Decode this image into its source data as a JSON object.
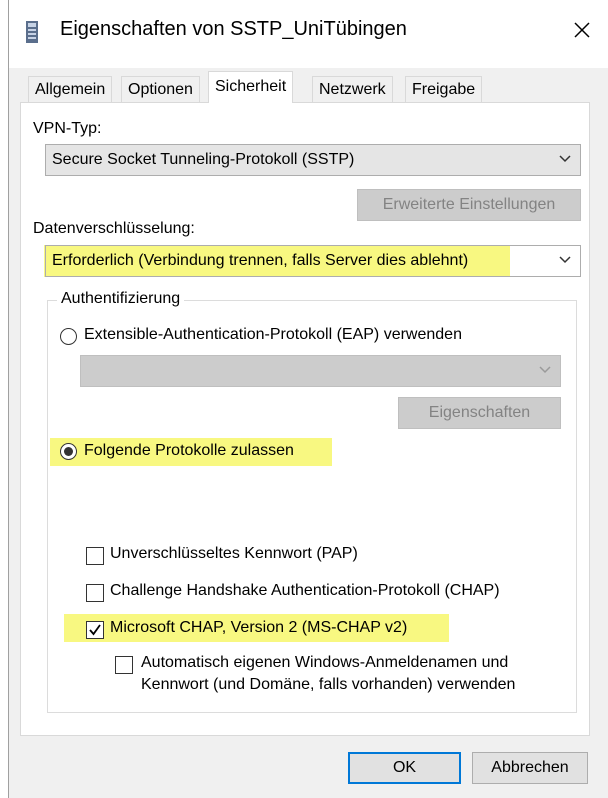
{
  "window": {
    "title": "Eigenschaften von SSTP_UniTübingen",
    "close_symbol": "✕"
  },
  "tabs": [
    {
      "label": "Allgemein",
      "active": false
    },
    {
      "label": "Optionen",
      "active": false
    },
    {
      "label": "Sicherheit",
      "active": true
    },
    {
      "label": "Netzwerk",
      "active": false
    },
    {
      "label": "Freigabe",
      "active": false
    }
  ],
  "vpn": {
    "label": "VPN-Typ:",
    "value": "Secure Socket Tunneling-Protokoll (SSTP)",
    "advanced_button": "Erweiterte Einstellungen"
  },
  "encryption": {
    "label": "Datenverschlüsselung:",
    "value": "Erforderlich (Verbindung trennen, falls Server dies ablehnt)"
  },
  "auth": {
    "group_title": "Authentifizierung",
    "eap_radio": "Extensible-Authentication-Protokoll (EAP) verwenden",
    "eap_selected": false,
    "eap_properties_button": "Eigenschaften",
    "protocols_radio": "Folgende Protokolle zulassen",
    "protocols_selected": true,
    "checkboxes": [
      {
        "label": "Unverschlüsseltes Kennwort (PAP)",
        "checked": false
      },
      {
        "label": "Challenge Handshake Authentication-Protokoll (CHAP)",
        "checked": false
      },
      {
        "label": "Microsoft CHAP, Version 2 (MS-CHAP v2)",
        "checked": true
      }
    ],
    "auto_windows": {
      "line1": "Automatisch eigenen Windows-Anmeldenamen und",
      "line2": "Kennwort (und Domäne, falls vorhanden) verwenden",
      "checked": false
    }
  },
  "footer": {
    "ok": "OK",
    "cancel": "Abbrechen"
  },
  "colors": {
    "highlight": "#f7f76b",
    "accent": "#0078d7"
  }
}
